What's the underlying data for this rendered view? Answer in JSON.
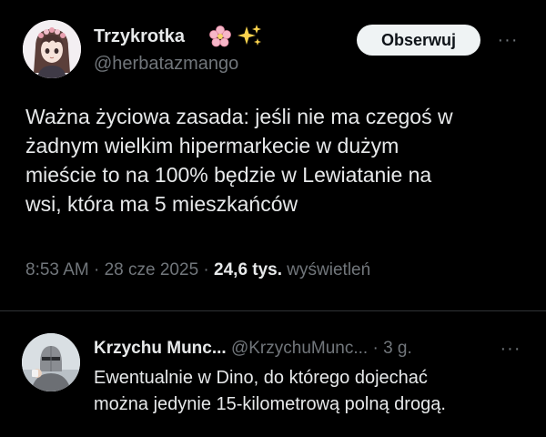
{
  "tweet": {
    "author": {
      "display_name": "Trzykrotka",
      "emojis": [
        "cherry-blossom-icon",
        "sparkles-icon"
      ],
      "handle": "@herbatazmango"
    },
    "follow_label": "Obserwuj",
    "more_label": "···",
    "text_lines": [
      "Ważna życiowa zasada: jeśli nie ma czegoś w",
      "żadnym wielkim hipermarkecie w dużym",
      "mieście to na 100% będzie w Lewiatanie na",
      "wsi, która ma 5 mieszkańców"
    ],
    "meta": {
      "time": "8:53 AM",
      "sep1": " · ",
      "date": "28 cze 2025",
      "sep2": " · ",
      "views_count": "24,6 tys.",
      "views_label": " wyświetleń"
    }
  },
  "reply": {
    "display_name": "Krzychu Munc...",
    "handle": "@KrzychuMunc...",
    "separator": " · ",
    "time": "3 g.",
    "more_label": "···",
    "text_lines": [
      "Ewentualnie w Dino, do którego dojechać",
      "można jedynie 15-kilometrową polną drogą."
    ]
  },
  "colors": {
    "background": "#000000",
    "text_primary": "#e7e9ea",
    "text_secondary": "#71767b",
    "button_bg": "#eff3f4",
    "divider": "#2f3336"
  }
}
